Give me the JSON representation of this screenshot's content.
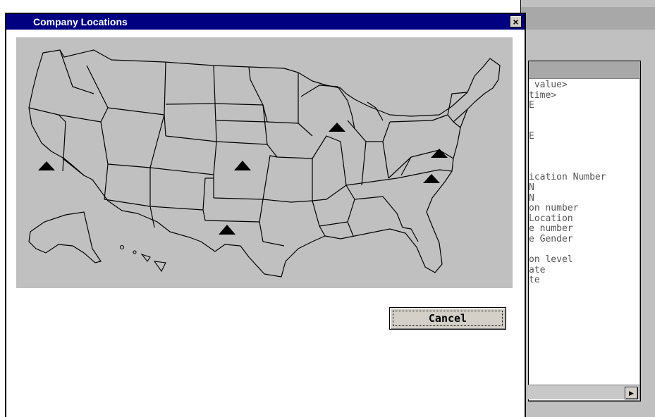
{
  "dialog": {
    "title": "Company Locations",
    "close_glyph": "×",
    "cancel_label": "Cancel"
  },
  "map": {
    "region": "United States",
    "markers": [
      {
        "name": "California"
      },
      {
        "name": "Kansas"
      },
      {
        "name": "Texas"
      },
      {
        "name": "Illinois"
      },
      {
        "name": "Virginia"
      },
      {
        "name": "North Carolina"
      }
    ],
    "marker_color": "#000000",
    "background_color": "#c0c0c0"
  },
  "background_window": {
    "list_items": [
      " value>",
      "time>",
      "E",
      "",
      "",
      "E",
      "",
      "",
      "",
      "ication Number",
      "N",
      "N",
      "on number",
      "Location",
      "e number",
      "e Gender",
      "",
      "on level",
      "ate",
      "te"
    ],
    "scroll_right_icon": "right-arrow-icon"
  },
  "colors": {
    "titlebar": "#000080",
    "titlebar_text": "#ffffff"
  }
}
